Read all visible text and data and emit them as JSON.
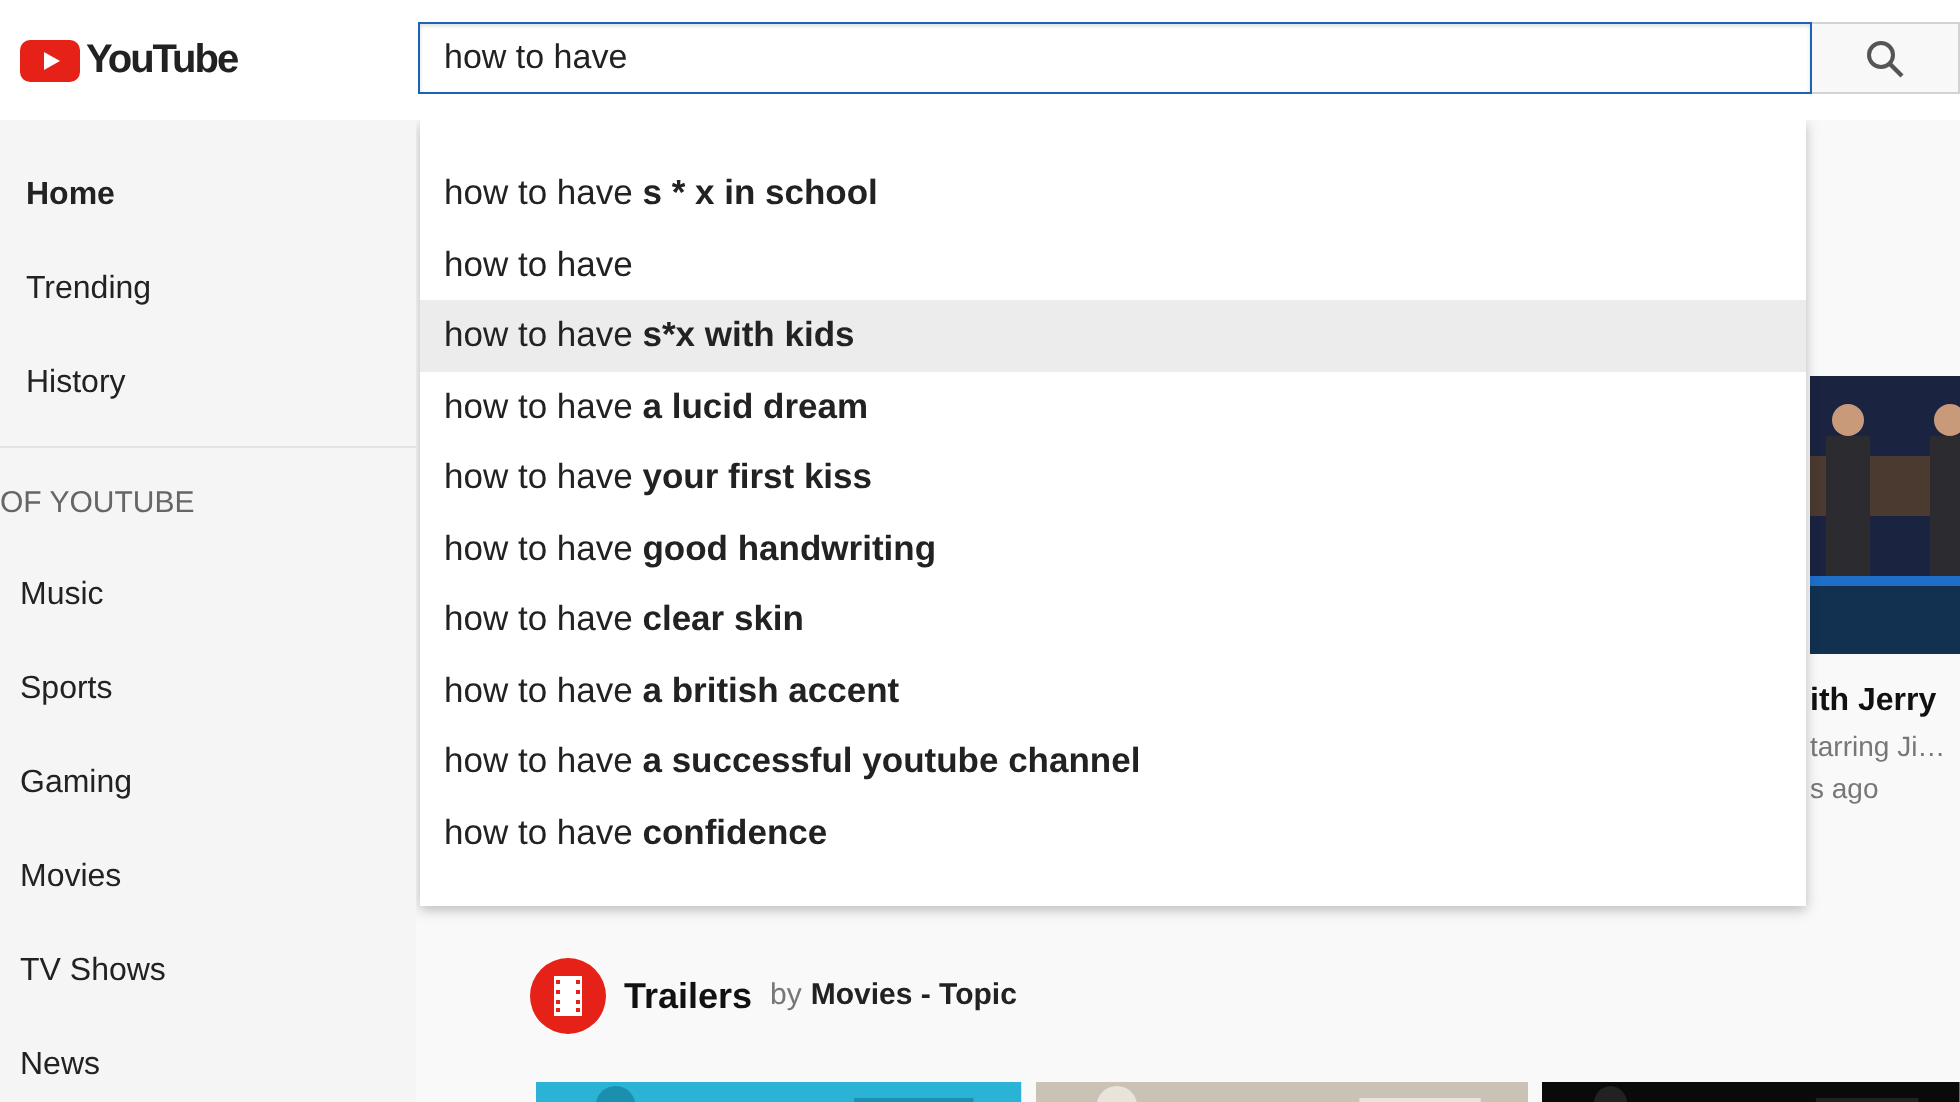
{
  "header": {
    "logo_text": "YouTube",
    "search": {
      "value": "how to have"
    }
  },
  "sidebar": {
    "items": [
      {
        "label": "Home",
        "selected": true
      },
      {
        "label": "Trending",
        "selected": false
      },
      {
        "label": "History",
        "selected": false
      }
    ],
    "section_title": "OF YOUTUBE",
    "section_items": [
      {
        "label": "Music",
        "selected": false
      },
      {
        "label": "Sports",
        "selected": false
      },
      {
        "label": "Gaming",
        "selected": false
      },
      {
        "label": "Movies",
        "selected": false
      },
      {
        "label": "TV Shows",
        "selected": false
      },
      {
        "label": "News",
        "selected": false
      }
    ]
  },
  "suggestions": [
    {
      "text": "how to have **s * x in school**",
      "selected": false
    },
    {
      "text": "how to have",
      "selected": false
    },
    {
      "text": "how to have **s*x with kids**",
      "selected": true
    },
    {
      "text": "how to have **a lucid dream**",
      "selected": false
    },
    {
      "text": "how to have **your first kiss**",
      "selected": false
    },
    {
      "text": "how to have **good handwriting**",
      "selected": false
    },
    {
      "text": "how to have **clear skin**",
      "selected": false
    },
    {
      "text": "how to have **a british accent**",
      "selected": false
    },
    {
      "text": "how to have **a successful youtube channel**",
      "selected": false
    },
    {
      "text": "how to have **confidence**",
      "selected": false
    }
  ],
  "video_card": {
    "kind": "picture",
    "title": "ith Jerry",
    "meta": [
      "tarring Ji…",
      "s ago"
    ]
  },
  "shelf": {
    "title": "Trailers",
    "by": "by",
    "channel": "Movies - Topic"
  }
}
